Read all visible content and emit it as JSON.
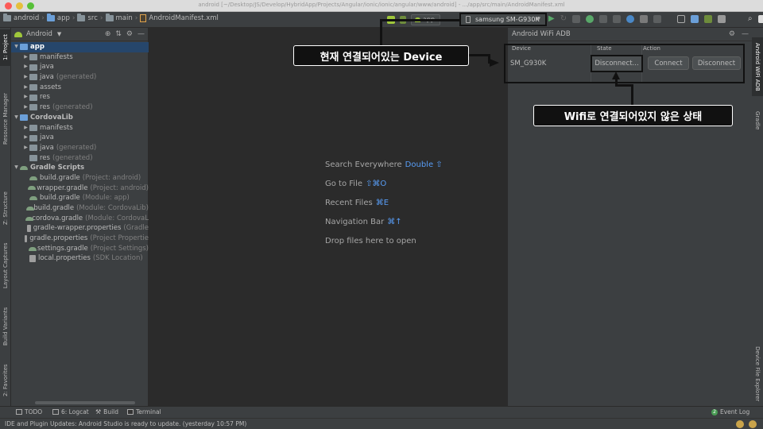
{
  "window": {
    "title": "android [~/Desktop/JS/Develop/HybridApp/Projects/Angular/ionic/ionic/angular/www/android] - .../app/src/main/AndroidManifest.xml"
  },
  "breadcrumbs": [
    "android",
    "app",
    "src",
    "main",
    "AndroidManifest.xml"
  ],
  "toolbar": {
    "run_config": "app",
    "device": "samsung SM-G930K"
  },
  "left_stripe": [
    "1: Project",
    "Resource Manager",
    "Z: Structure",
    "Layout Captures",
    "Build Variants",
    "2: Favorites"
  ],
  "project_panel": {
    "view_mode": "Android",
    "tree": [
      {
        "label": "app",
        "hint": "",
        "level": 0,
        "expanded": true,
        "selected": true,
        "icon": "module-folder"
      },
      {
        "label": "manifests",
        "hint": "",
        "level": 1,
        "expanded": false,
        "icon": "folder"
      },
      {
        "label": "java",
        "hint": "",
        "level": 1,
        "expanded": false,
        "icon": "folder"
      },
      {
        "label": "java",
        "hint": "(generated)",
        "level": 1,
        "expanded": false,
        "icon": "folder-gen"
      },
      {
        "label": "assets",
        "hint": "",
        "level": 1,
        "expanded": false,
        "icon": "folder"
      },
      {
        "label": "res",
        "hint": "",
        "level": 1,
        "expanded": false,
        "icon": "folder-res"
      },
      {
        "label": "res",
        "hint": "(generated)",
        "level": 1,
        "expanded": false,
        "icon": "folder-res"
      },
      {
        "label": "CordovaLib",
        "hint": "",
        "level": 0,
        "expanded": true,
        "icon": "module-folder"
      },
      {
        "label": "manifests",
        "hint": "",
        "level": 1,
        "expanded": false,
        "icon": "folder"
      },
      {
        "label": "java",
        "hint": "",
        "level": 1,
        "expanded": false,
        "icon": "folder"
      },
      {
        "label": "java",
        "hint": "(generated)",
        "level": 1,
        "expanded": false,
        "icon": "folder-gen"
      },
      {
        "label": "res",
        "hint": "(generated)",
        "level": 1,
        "leaf": true,
        "icon": "folder-res"
      },
      {
        "label": "Gradle Scripts",
        "hint": "",
        "level": 0,
        "expanded": true,
        "icon": "gradle"
      },
      {
        "label": "build.gradle",
        "hint": "(Project: android)",
        "level": 1,
        "leaf": true,
        "icon": "gradle"
      },
      {
        "label": "wrapper.gradle",
        "hint": "(Project: android)",
        "level": 1,
        "leaf": true,
        "icon": "gradle"
      },
      {
        "label": "build.gradle",
        "hint": "(Module: app)",
        "level": 1,
        "leaf": true,
        "icon": "gradle"
      },
      {
        "label": "build.gradle",
        "hint": "(Module: CordovaLib)",
        "level": 1,
        "leaf": true,
        "icon": "gradle"
      },
      {
        "label": "cordova.gradle",
        "hint": "(Module: CordovaL",
        "level": 1,
        "leaf": true,
        "icon": "gradle"
      },
      {
        "label": "gradle-wrapper.properties",
        "hint": "(Gradle",
        "level": 1,
        "leaf": true,
        "icon": "prop"
      },
      {
        "label": "gradle.properties",
        "hint": "(Project Propertie",
        "level": 1,
        "leaf": true,
        "icon": "prop"
      },
      {
        "label": "settings.gradle",
        "hint": "(Project Settings)",
        "level": 1,
        "leaf": true,
        "icon": "gradle"
      },
      {
        "label": "local.properties",
        "hint": "(SDK Location)",
        "level": 1,
        "leaf": true,
        "icon": "prop"
      }
    ]
  },
  "editor": {
    "hints": [
      {
        "label": "Search Everywhere",
        "key": "Double ⇧"
      },
      {
        "label": "Go to File",
        "key": "⇧⌘O"
      },
      {
        "label": "Recent Files",
        "key": "⌘E"
      },
      {
        "label": "Navigation Bar",
        "key": "⌘↑"
      },
      {
        "label": "Drop files here to open",
        "key": ""
      }
    ]
  },
  "wifi_panel": {
    "title": "Android WiFi ADB",
    "columns": [
      "Device",
      "State",
      "Action"
    ],
    "row": {
      "device": "SM_G930K",
      "state": "Disconnect...",
      "connect_label": "Connect",
      "disconnect_label": "Disconnect"
    }
  },
  "right_stripe": [
    "Android WiFi ADB",
    "Gradle",
    "Device File Explorer"
  ],
  "bottom_tabs": [
    {
      "label": "TODO"
    },
    {
      "label": "6: Logcat"
    },
    {
      "label": "Build"
    },
    {
      "label": "Terminal"
    }
  ],
  "event_log": {
    "count": "2",
    "label": "Event Log"
  },
  "status": "IDE and Plugin Updates: Android Studio is ready to update. (yesterday 10:57 PM)",
  "annotations": {
    "connected_device": "현재 연결되어있는 Device",
    "not_wifi": "Wifi로 연결되어있지 않은 상태"
  }
}
